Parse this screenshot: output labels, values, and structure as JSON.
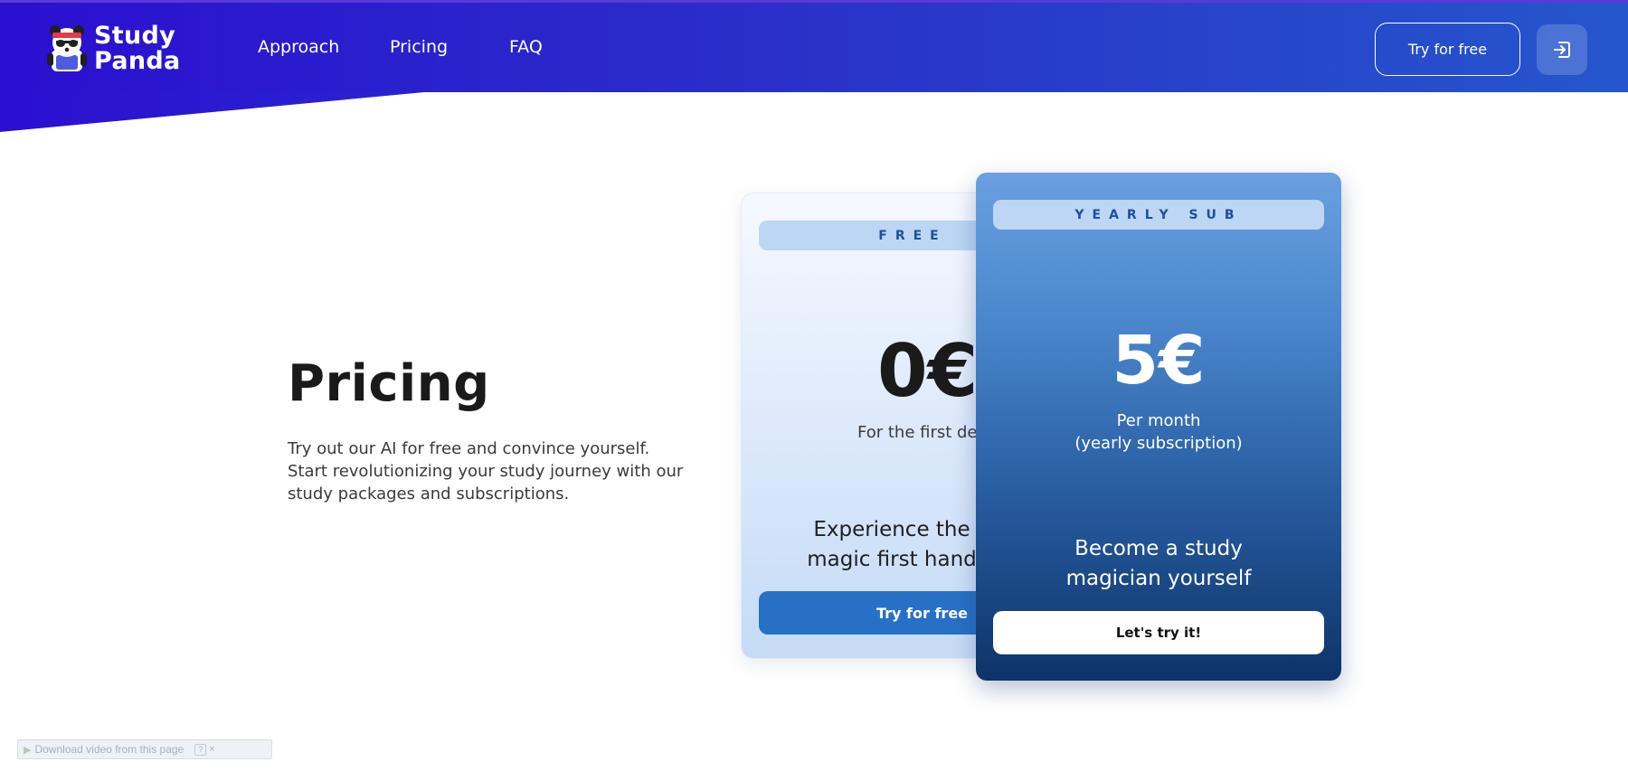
{
  "brand": {
    "name_line1": "Study",
    "name_line2": "Panda",
    "icon": "panda-logo-icon"
  },
  "nav": {
    "items": [
      {
        "label": "Approach"
      },
      {
        "label": "Pricing"
      },
      {
        "label": "FAQ"
      }
    ]
  },
  "header": {
    "try_label": "Try for free",
    "login_icon": "login-icon"
  },
  "hero": {
    "title": "Pricing",
    "description": "Try out our AI for free and convince yourself. Start revolutionizing your study journey with our study packages and subscriptions."
  },
  "plans": {
    "free": {
      "badge": "FREE",
      "price": "0€",
      "subtitle": "For the first decade",
      "tagline_line1": "Experience the",
      "tagline_line2": "magic first hand",
      "cta": "Try for free"
    },
    "yearly": {
      "badge": "YEARLY SUB",
      "price": "5€",
      "subtitle_line1": "Per month",
      "subtitle_line2": "(yearly subscription)",
      "tagline_line1": "Become a study",
      "tagline_line2": "magician yourself",
      "cta": "Let's try it!"
    }
  },
  "download_bar": {
    "text": "Download video from this page",
    "help": "?",
    "close": "×"
  },
  "colors": {
    "header_start": "#2b0fd1",
    "header_end": "#2556cc",
    "free_button": "#2870c6",
    "yearly_card_top": "#6aa0e0",
    "yearly_card_bottom": "#0e3369",
    "badge_bg": "#bcd6f4",
    "badge_text": "#1e4f9c"
  }
}
